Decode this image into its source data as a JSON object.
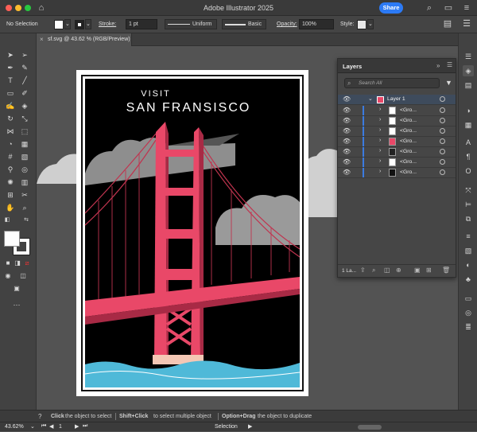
{
  "app": {
    "title": "Adobe Illustrator 2025",
    "share_label": "Share"
  },
  "control_bar": {
    "selection": "No Selection",
    "stroke_label": "Stroke:",
    "stroke_value": "1 pt",
    "profile_label": "Uniform",
    "brush_label": "Basic",
    "opacity_label": "Opacity:",
    "opacity_value": "100%",
    "style_label": "Style:"
  },
  "document": {
    "tab_label": "sf.svg @ 43.62 % (RGB/Preview)"
  },
  "poster": {
    "line1": "VISIT",
    "line2": "SAN FRANSISCO"
  },
  "layers_panel": {
    "title": "Layers",
    "search_placeholder": "Search All",
    "layer_name": "Layer 1",
    "sublayers": [
      "<Gro...",
      "<Gro...",
      "<Gro...",
      "<Gro...",
      "<Gro...",
      "<Gro...",
      "<Gro..."
    ],
    "footer_count": "1 La..."
  },
  "status": {
    "hint_click": "Click",
    "hint_text1": "the object to select",
    "hint_shift": "Shift+Click",
    "hint_text2": "to select multiple object",
    "hint_option": "Option+Drag",
    "hint_text3": "the object to duplicate",
    "zoom": "43.62%",
    "page": "1",
    "mode": "Selection"
  },
  "colors": {
    "accent": "#2c7af5",
    "bridge": "#e94868",
    "water": "#4fb9d8",
    "sky": "#000000"
  }
}
